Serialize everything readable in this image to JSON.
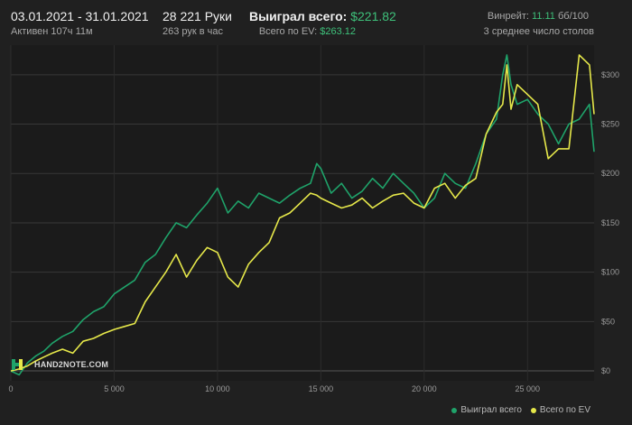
{
  "header": {
    "date_range": "03.01.2021 - 31.01.2021",
    "active": "Активен 107ч 11м",
    "hands": "28 221 Руки",
    "hands_per_hour": "263 рук в час",
    "won_label": "Выиграл всего:",
    "won_value": "$221.82",
    "ev_label": "Всего по EV:",
    "ev_value": "$263.12",
    "winrate_label": "Винрейт:",
    "winrate_value": "11.11",
    "winrate_unit": "бб/100",
    "tables": "3 среднее число столов"
  },
  "logo": {
    "text": "HAND2NOTE.COM"
  },
  "colors": {
    "won": "#1fa36a",
    "ev": "#e6e84a",
    "background": "#202020",
    "grid": "#3a3a3a"
  },
  "chart_data": {
    "type": "line",
    "xlabel": "",
    "ylabel": "",
    "xlim": [
      0,
      28221
    ],
    "ylim": [
      -10,
      330
    ],
    "x_ticks": [
      {
        "value": 0,
        "label": "0"
      },
      {
        "value": 5000,
        "label": "5 000"
      },
      {
        "value": 10000,
        "label": "10 000"
      },
      {
        "value": 15000,
        "label": "15 000"
      },
      {
        "value": 20000,
        "label": "20 000"
      },
      {
        "value": 25000,
        "label": "25 000"
      }
    ],
    "y_ticks": [
      {
        "value": 0,
        "label": "$0"
      },
      {
        "value": 50,
        "label": "$50"
      },
      {
        "value": 100,
        "label": "$100"
      },
      {
        "value": 150,
        "label": "$150"
      },
      {
        "value": 200,
        "label": "$200"
      },
      {
        "value": 250,
        "label": "$250"
      },
      {
        "value": 300,
        "label": "$300"
      }
    ],
    "grid": true,
    "legend_position": "bottom-right",
    "series": [
      {
        "name": "Выиграл всего",
        "color": "#1fa36a",
        "x": [
          0,
          400,
          800,
          1200,
          1600,
          2000,
          2500,
          3000,
          3500,
          4000,
          4500,
          5000,
          5500,
          6000,
          6500,
          7000,
          7500,
          8000,
          8500,
          9000,
          9500,
          10000,
          10500,
          11000,
          11500,
          12000,
          12500,
          13000,
          13500,
          14000,
          14500,
          14800,
          15000,
          15500,
          16000,
          16500,
          17000,
          17500,
          18000,
          18500,
          19000,
          19500,
          20000,
          20500,
          21000,
          21500,
          22000,
          22500,
          23000,
          23500,
          23800,
          24000,
          24200,
          24500,
          25000,
          25500,
          26000,
          26500,
          27000,
          27500,
          28000,
          28221
        ],
        "values": [
          0,
          -4,
          8,
          15,
          20,
          28,
          35,
          40,
          52,
          60,
          65,
          78,
          85,
          92,
          110,
          118,
          135,
          150,
          145,
          158,
          170,
          185,
          160,
          172,
          165,
          180,
          175,
          170,
          178,
          185,
          190,
          210,
          205,
          180,
          190,
          175,
          182,
          195,
          185,
          200,
          190,
          180,
          165,
          175,
          200,
          190,
          185,
          210,
          240,
          255,
          300,
          320,
          290,
          270,
          275,
          260,
          250,
          230,
          250,
          255,
          270,
          222
        ]
      },
      {
        "name": "Всего по EV",
        "color": "#e6e84a",
        "x": [
          0,
          400,
          800,
          1200,
          1600,
          2000,
          2500,
          3000,
          3500,
          4000,
          4500,
          5000,
          5500,
          6000,
          6500,
          7000,
          7500,
          8000,
          8500,
          9000,
          9500,
          10000,
          10500,
          11000,
          11500,
          12000,
          12500,
          13000,
          13500,
          14000,
          14500,
          14800,
          15000,
          15500,
          16000,
          16500,
          17000,
          17500,
          18000,
          18500,
          19000,
          19500,
          20000,
          20500,
          21000,
          21500,
          22000,
          22500,
          23000,
          23500,
          23800,
          24000,
          24200,
          24500,
          25000,
          25500,
          26000,
          26500,
          27000,
          27500,
          28000,
          28221
        ],
        "values": [
          0,
          2,
          5,
          10,
          14,
          18,
          22,
          18,
          30,
          33,
          38,
          42,
          45,
          48,
          70,
          85,
          100,
          118,
          95,
          112,
          125,
          120,
          95,
          85,
          108,
          120,
          130,
          155,
          160,
          170,
          180,
          178,
          175,
          170,
          165,
          168,
          175,
          165,
          172,
          178,
          180,
          170,
          165,
          185,
          190,
          175,
          188,
          195,
          240,
          262,
          270,
          310,
          265,
          290,
          280,
          270,
          215,
          225,
          225,
          320,
          310,
          260
        ]
      }
    ]
  }
}
